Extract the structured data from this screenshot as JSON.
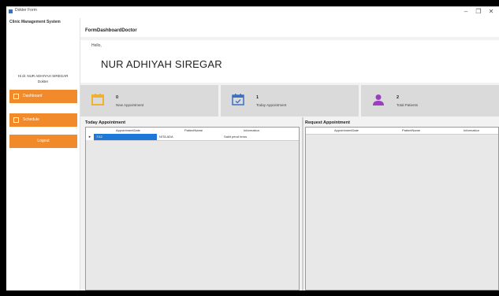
{
  "window": {
    "title": "Dokter Form",
    "minimize": "–",
    "maximize": "❐",
    "close": "✕"
  },
  "sidebar": {
    "brand": "Clinic Management System",
    "welcome_line1": "Hi dr. NUR ADHIYAH SIREGAR",
    "welcome_line2": "Dokter",
    "buttons": [
      {
        "label": "Dashboard",
        "icon": "dashboard-icon"
      },
      {
        "label": "Schedule",
        "icon": "calendar-icon"
      },
      {
        "label": "Logout",
        "icon": ""
      }
    ],
    "accent": "#f08a2a"
  },
  "header": {
    "form_title": "FormDashboardDoctor"
  },
  "user": {
    "greeting": "Hello,",
    "name": "NUR ADHIYAH SIREGAR"
  },
  "stats": [
    {
      "count": "0",
      "label": "New Appointment",
      "icon": "calendar-icon",
      "color": "#f0b030"
    },
    {
      "count": "1",
      "label": "Today Appointment",
      "icon": "calendar-check-icon",
      "color": "#3a6fc4"
    },
    {
      "count": "2",
      "label": "Total Patients",
      "icon": "user-icon",
      "color": "#9a3fbf"
    }
  ],
  "today_grid": {
    "title": "Today Appointment",
    "columns": [
      "AppointmentDate",
      "PatientName",
      "Information"
    ],
    "rows": [
      {
        "date": "7/12",
        "patient": "NITA ADA",
        "info": "Sakit perut terus"
      }
    ]
  },
  "request_grid": {
    "title": "Request Appointment",
    "columns": [
      "AppointmentDate",
      "PatientName",
      "Information"
    ],
    "rows": []
  },
  "colors": {
    "selection": "#1e78d7",
    "stat_bg": "#dadada"
  }
}
